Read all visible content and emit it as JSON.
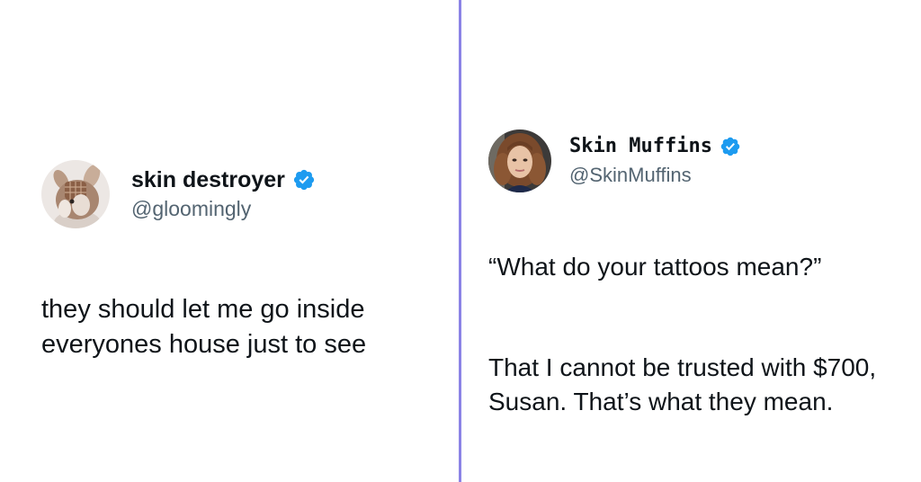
{
  "tweets": [
    {
      "display_name": "skin destroyer",
      "handle": "@gloomingly",
      "verified": true,
      "avatar_icon": "bunny-plush-avatar",
      "paragraphs": [
        "they should let me go inside\neveryones house just to see"
      ]
    },
    {
      "display_name": "Skin Muffins",
      "handle": "@SkinMuffins",
      "verified": true,
      "avatar_icon": "woman-portrait-avatar",
      "paragraphs": [
        "“What do your tattoos mean?”",
        "That I cannot be trusted with $700,\nSusan. That’s what they mean."
      ]
    }
  ],
  "colors": {
    "divider": "#8b83e6",
    "verified_badge": "#1d9bf0",
    "handle_text": "#536471"
  }
}
